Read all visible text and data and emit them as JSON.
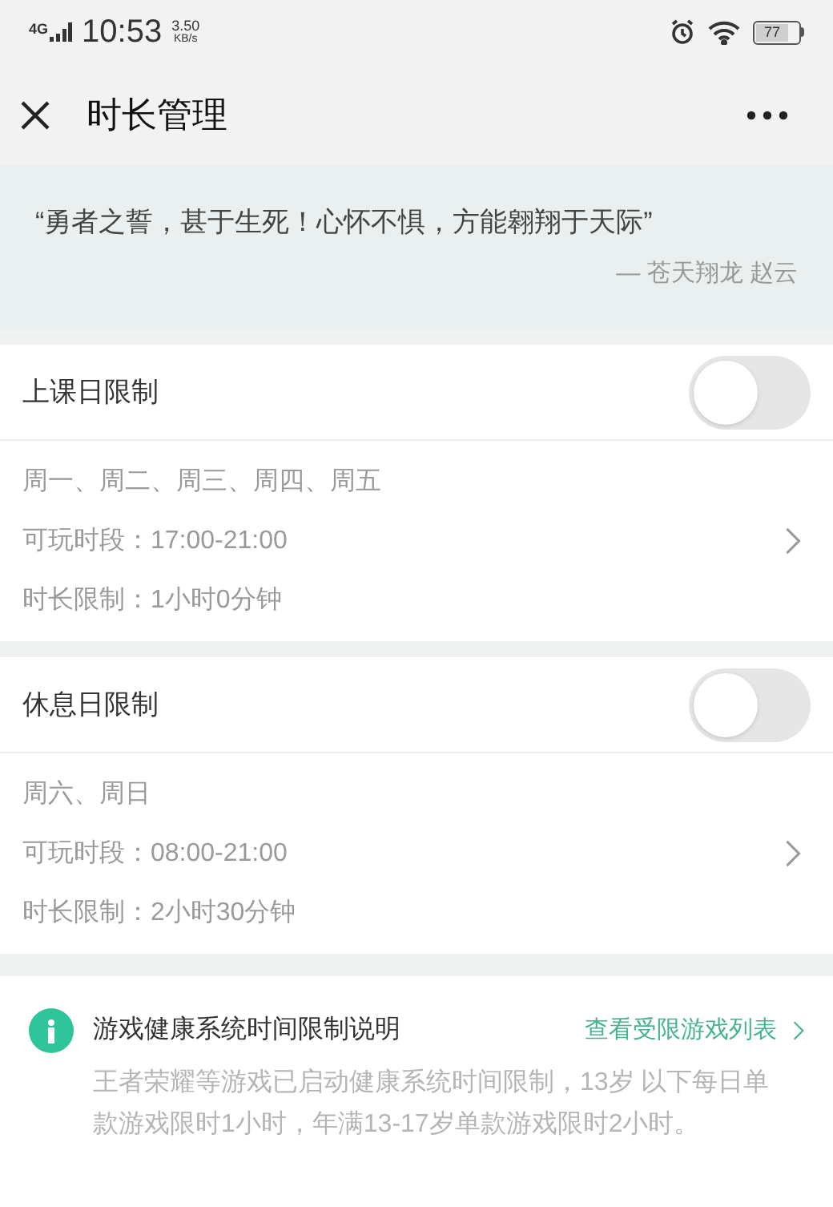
{
  "status_bar": {
    "network": "4G",
    "time": "10:53",
    "speed": "3.50",
    "speed_unit": "KB/s",
    "battery": "77"
  },
  "header": {
    "title": "时长管理"
  },
  "quote": {
    "text": "“勇者之誓，甚于生死！心怀不惧，方能翱翔于天际”",
    "attribution": "— 苍天翔龙 赵云"
  },
  "limits": [
    {
      "title": "上课日限制",
      "on": false,
      "days": "周一、周二、周三、周四、周五",
      "period": "可玩时段：17:00-21:00",
      "duration": "时长限制：1小时0分钟"
    },
    {
      "title": "休息日限制",
      "on": false,
      "days": "周六、周日",
      "period": "可玩时段：08:00-21:00",
      "duration": "时长限制：2小时30分钟"
    }
  ],
  "notice": {
    "title": "游戏健康系统时间限制说明",
    "link": "查看受限游戏列表",
    "body": "王者荣耀等游戏已启动健康系统时间限制，13岁 以下每日单款游戏限时1小时，年满13-17岁单款游戏限时2小时。"
  }
}
